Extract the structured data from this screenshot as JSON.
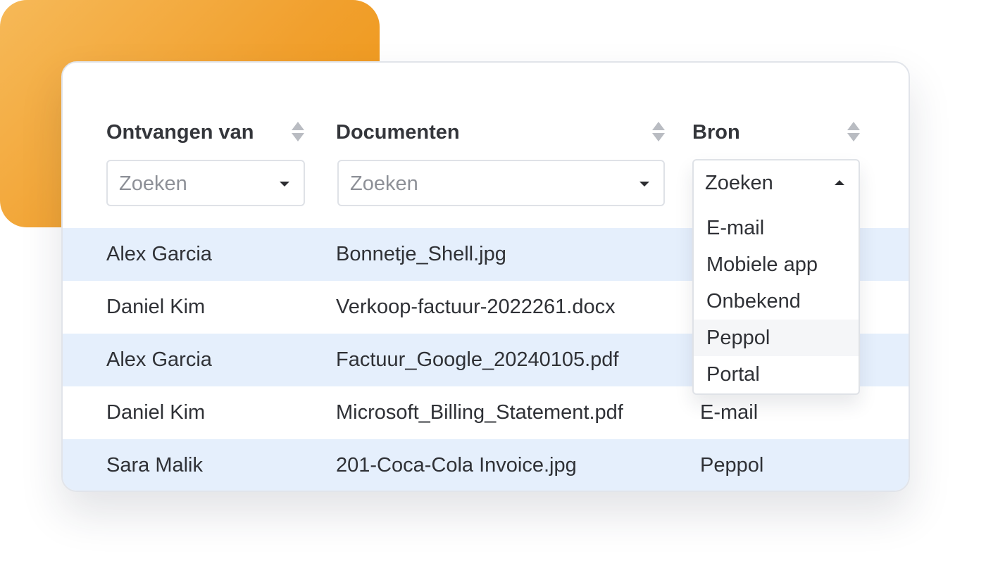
{
  "colors": {
    "accent_orange": "#f1a02e",
    "row_highlight": "#e5effc",
    "option_hover": "#f5f6f8"
  },
  "table": {
    "columns": [
      {
        "label": "Ontvangen van",
        "sort_icon": "sort-icon",
        "search_placeholder": "Zoeken"
      },
      {
        "label": "Documenten",
        "sort_icon": "sort-icon",
        "search_placeholder": "Zoeken"
      },
      {
        "label": "Bron",
        "sort_icon": "sort-icon",
        "search_value": "Zoeken"
      }
    ],
    "rows": [
      {
        "from": "Alex Garcia",
        "document": "Bonnetje_Shell.jpg",
        "source": ""
      },
      {
        "from": "Daniel Kim",
        "document": "Verkoop-factuur-2022261.docx",
        "source": ""
      },
      {
        "from": "Alex Garcia",
        "document": "Factuur_Google_20240105.pdf",
        "source": ""
      },
      {
        "from": "Daniel Kim",
        "document": "Microsoft_Billing_Statement.pdf",
        "source": "E-mail"
      },
      {
        "from": "Sara Malik",
        "document": "201-Coca-Cola Invoice.jpg",
        "source": "Peppol"
      }
    ]
  },
  "source_dropdown": {
    "open": true,
    "current": "Zoeken",
    "options": [
      "E-mail",
      "Mobiele app",
      "Onbekend",
      "Peppol",
      "Portal"
    ],
    "hovered": "Peppol"
  }
}
